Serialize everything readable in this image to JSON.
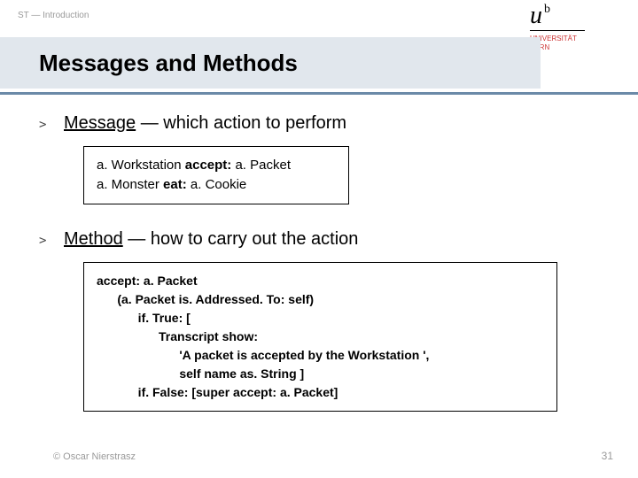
{
  "header": {
    "label": "ST — Introduction"
  },
  "logo": {
    "u": "u",
    "b": "b",
    "line1": "UNIVERSITÄT",
    "line2": "BERN"
  },
  "title": "Messages and Methods",
  "bullets": [
    {
      "term": "Message",
      "rest": " — which action to perform"
    },
    {
      "term": "Method",
      "rest": " — how to carry out the action"
    }
  ],
  "box1": {
    "l1a": "a. Workstation ",
    "l1b": "accept:",
    "l1c": " a. Packet",
    "l2a": "a. Monster ",
    "l2b": "eat:",
    "l2c": " a. Cookie"
  },
  "box2": {
    "l1a": "accept:",
    "l1b": " a. Packet",
    "l2": "      (a. Packet is. Addressed. To: self)",
    "l3": "            if. True: [",
    "l4": "                  Transcript show:",
    "l5": "                        'A packet is accepted by the Workstation ',",
    "l6": "                        self name as. String ]",
    "l7": "            if. False: [super accept: a. Packet]"
  },
  "footer": {
    "copyright": "© Oscar Nierstrasz",
    "page": "31"
  }
}
